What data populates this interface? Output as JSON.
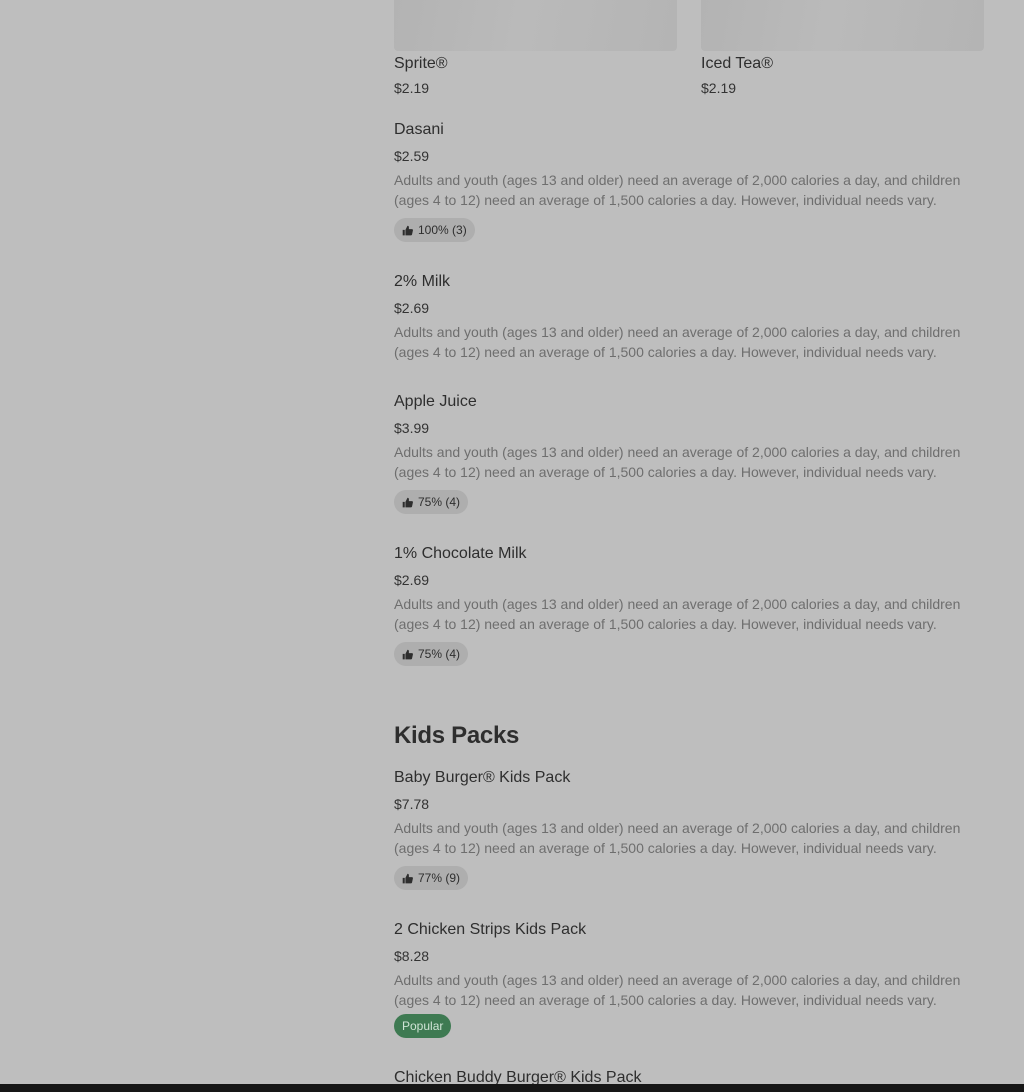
{
  "top_tiles": [
    {
      "name": "Sprite®",
      "price": "$2.19"
    },
    {
      "name": "Iced Tea®",
      "price": "$2.19"
    }
  ],
  "drinks": [
    {
      "name": "Dasani",
      "price": "$2.59",
      "description": "Adults and youth (ages 13 and older) need an average of 2,000 calories a day, and children (ages 4 to 12) need an average of 1,500 calories a day. However, individual needs vary.",
      "rating": "100% (3)"
    },
    {
      "name": "2% Milk",
      "price": "$2.69",
      "description": "Adults and youth (ages 13 and older) need an average of 2,000 calories a day, and children (ages 4 to 12) need an average of 1,500 calories a day. However, individual needs vary."
    },
    {
      "name": "Apple Juice",
      "price": "$3.99",
      "description": "Adults and youth (ages 13 and older) need an average of 2,000 calories a day, and children (ages 4 to 12) need an average of 1,500 calories a day. However, individual needs vary.",
      "rating": "75% (4)"
    },
    {
      "name": "1% Chocolate Milk",
      "price": "$2.69",
      "description": "Adults and youth (ages 13 and older) need an average of 2,000 calories a day, and children (ages 4 to 12) need an average of 1,500 calories a day. However, individual needs vary.",
      "rating": "75% (4)"
    }
  ],
  "kids_packs": {
    "title": "Kids Packs",
    "items": [
      {
        "name": "Baby Burger® Kids Pack",
        "price": "$7.78",
        "description": "Adults and youth (ages 13 and older) need an average of 2,000 calories a day, and children (ages 4 to 12) need an average of 1,500 calories a day. However, individual needs vary.",
        "rating": "77% (9)"
      },
      {
        "name": "2 Chicken Strips Kids Pack",
        "price": "$8.28",
        "description": "Adults and youth (ages 13 and older) need an average of 2,000 calories a day, and children (ages 4 to 12) need an average of 1,500 calories a day. However, individual needs vary.",
        "badge": "Popular"
      },
      {
        "name": "Chicken Buddy Burger® Kids Pack"
      }
    ]
  },
  "colors": {
    "background": "#bebebe",
    "popular_badge": "#3e7a52",
    "rating_pill": "#aeaeae"
  }
}
